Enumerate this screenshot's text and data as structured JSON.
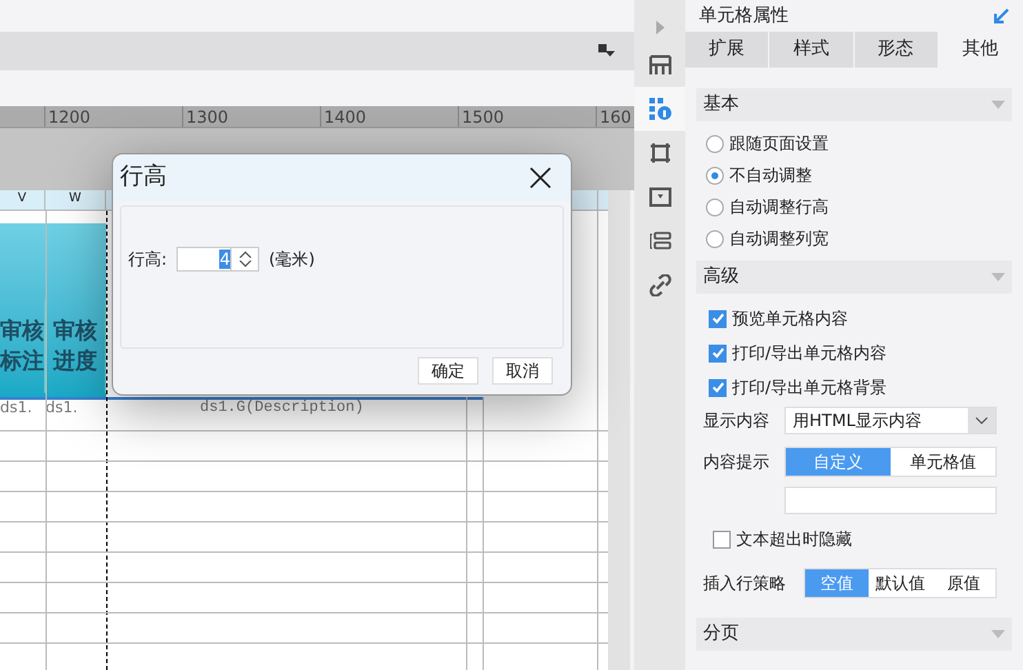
{
  "ruler": {
    "labels": [
      "1200",
      "1300",
      "1400",
      "1500",
      "160"
    ]
  },
  "columns": [
    "V",
    "W"
  ],
  "sheet": {
    "headers": [
      {
        "line1": "审核",
        "line2": "标注"
      },
      {
        "line1": "审核",
        "line2": "进度"
      }
    ],
    "cells": [
      "ds1.",
      "ds1.",
      "ds1.G(Description)"
    ]
  },
  "dialog": {
    "title": "行高",
    "field_label": "行高:",
    "value": "4",
    "unit": "(毫米)",
    "buttons": [
      "确定",
      "取消"
    ]
  },
  "panel": {
    "title": "单元格属性",
    "side_tabs": [
      {
        "kind": "expand",
        "selected": false
      },
      {
        "kind": "grid",
        "selected": false
      },
      {
        "kind": "cellinfo",
        "selected": true
      },
      {
        "kind": "frame",
        "selected": false
      },
      {
        "kind": "widget",
        "selected": false
      },
      {
        "kind": "bars",
        "selected": false
      },
      {
        "kind": "link",
        "selected": false
      }
    ],
    "tabs": [
      {
        "label": "扩展",
        "selected": false
      },
      {
        "label": "样式",
        "selected": false
      },
      {
        "label": "形态",
        "selected": false
      },
      {
        "label": "其他",
        "selected": true
      }
    ],
    "basic": {
      "title": "基本",
      "options": [
        {
          "label": "跟随页面设置",
          "selected": false
        },
        {
          "label": "不自动调整",
          "selected": true
        },
        {
          "label": "自动调整行高",
          "selected": false
        },
        {
          "label": "自动调整列宽",
          "selected": false
        }
      ]
    },
    "advanced": {
      "title": "高级",
      "checks": [
        {
          "label": "预览单元格内容",
          "checked": true
        },
        {
          "label": "打印/导出单元格内容",
          "checked": true
        },
        {
          "label": "打印/导出单元格背景",
          "checked": true
        }
      ],
      "display": {
        "label": "显示内容",
        "value": "用HTML显示内容"
      },
      "tip": {
        "label": "内容提示",
        "options": [
          {
            "label": "自定义",
            "selected": true
          },
          {
            "label": "单元格值",
            "selected": false
          }
        ]
      },
      "hide": {
        "label": "文本超出时隐藏",
        "checked": false
      },
      "insert": {
        "label": "插入行策略",
        "options": [
          {
            "label": "空值",
            "selected": true
          },
          {
            "label": "默认值",
            "selected": false
          },
          {
            "label": "原值",
            "selected": false
          }
        ]
      }
    },
    "paging": {
      "title": "分页"
    }
  }
}
